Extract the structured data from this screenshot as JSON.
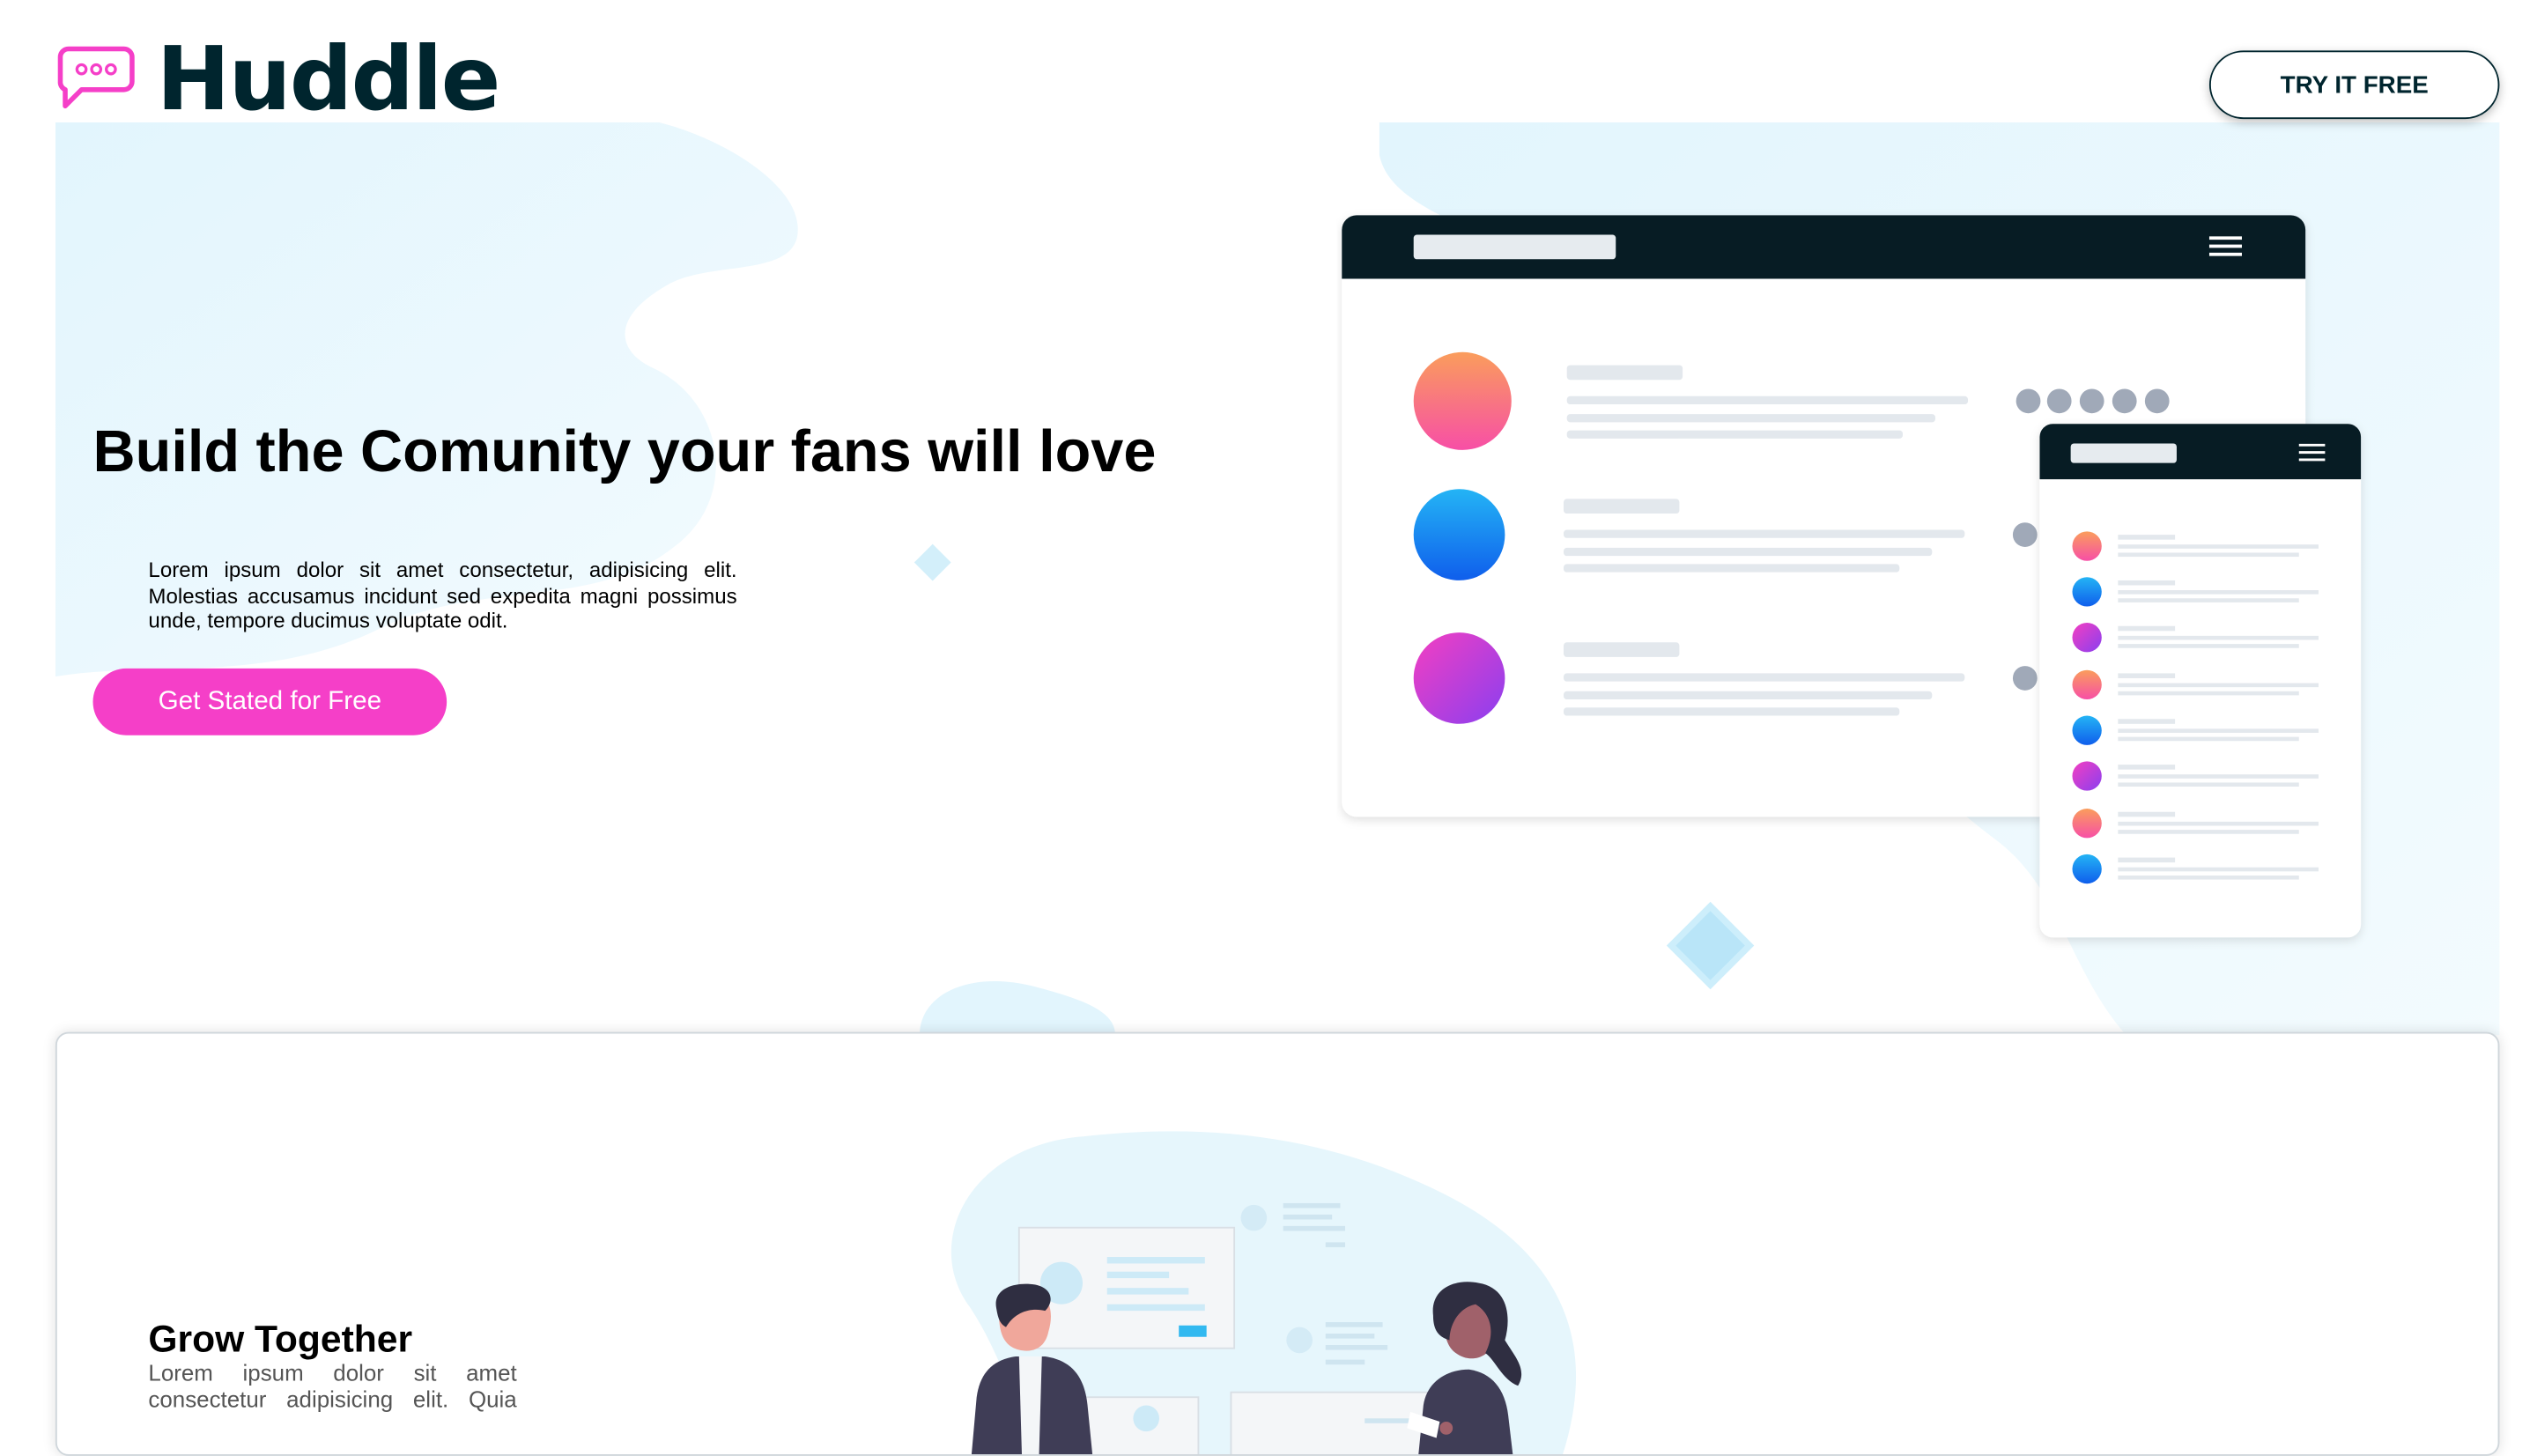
{
  "header": {
    "logo_text": "Huddle",
    "try_label": "TRY IT FREE"
  },
  "hero": {
    "headline": "Build the Comunity your fans will love",
    "body": "Lorem ipsum dolor sit amet consectetur, adipisicing elit. Molestias accusamus incidunt sed expedita magni possimus unde, tempore ducimus voluptate odit.",
    "cta_label": "Get Stated for Free"
  },
  "section_grow": {
    "title": "Grow Together",
    "body": "Lorem ipsum dolor sit amet consectetur adipisicing elit. Quia"
  },
  "colors": {
    "brand_dark": "#00252e",
    "accent_pink": "#f53fc8",
    "blob_blue": "#e6f6fc"
  },
  "icons": [
    "chat-bubble-icon",
    "hamburger-menu-icon"
  ]
}
